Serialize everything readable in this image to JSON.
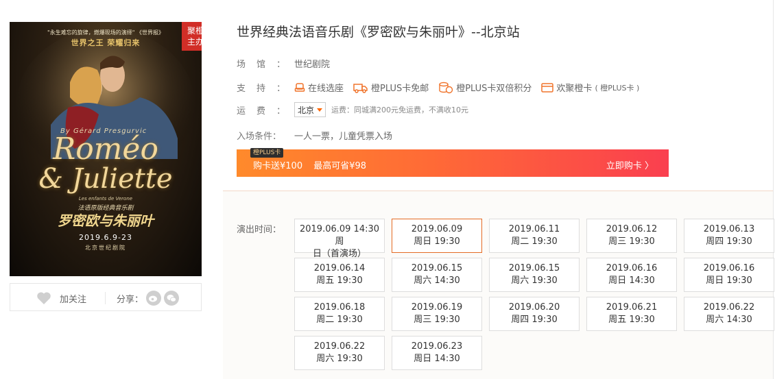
{
  "poster": {
    "tag": "聚橙\n主办",
    "quote": "\"永生难忘的旋律，燃爆现场的演绎\" 《世界报》",
    "slogan": "世界之王  荣耀归来",
    "author": "By Gérard Presgurvic",
    "title_line1": "Roméo",
    "title_line2": "& Juliette",
    "small_line": "Les enfants de Verone",
    "sub": "法语原版经典音乐剧",
    "cn_title": "罗密欧与朱丽叶",
    "dates": "2019.6.9-23",
    "venue": "北京世纪剧院"
  },
  "follow": {
    "label": "加关注",
    "icon": "heart-icon"
  },
  "share": {
    "label": "分享：",
    "icons": [
      "weibo-icon",
      "wechat-icon"
    ]
  },
  "title": "世界经典法语音乐剧《罗密欧与朱丽叶》--北京站",
  "venue": {
    "label": "场    馆：",
    "value": "世纪剧院"
  },
  "support": {
    "label": "支    持：",
    "items": [
      {
        "label": "在线选座",
        "icon": "seat-icon"
      },
      {
        "label": "橙PLUS卡免邮",
        "icon": "truck-icon"
      },
      {
        "label": "橙PLUS卡双倍积分",
        "icon": "coins-icon"
      },
      {
        "label": "欢聚橙卡",
        "note": "( 橙PLUS卡 )",
        "icon": "card-icon"
      }
    ]
  },
  "shipping": {
    "label": "运    费：",
    "city": "北京",
    "note": "运费：同城满200元免运费，不满收10元"
  },
  "entry": {
    "label": "入场条件：",
    "value": "一人一票，儿童凭票入场"
  },
  "promo": {
    "badge": "橙PLUS卡",
    "text1": "购卡送¥100",
    "text2": "最高可省¥98",
    "link": "立即购卡 〉"
  },
  "schedule": {
    "label": "演出时间：",
    "dates": [
      {
        "line1": "2019.06.09 14:30 周",
        "line2": "日（首演场）"
      },
      {
        "line1": "2019.06.09",
        "line2": "周日 19:30",
        "selected": true
      },
      {
        "line1": "2019.06.11",
        "line2": "周二 19:30"
      },
      {
        "line1": "2019.06.12",
        "line2": "周三 19:30"
      },
      {
        "line1": "2019.06.13",
        "line2": "周四 19:30"
      },
      {
        "line1": "2019.06.14",
        "line2": "周五 19:30"
      },
      {
        "line1": "2019.06.15",
        "line2": "周六 14:30"
      },
      {
        "line1": "2019.06.15",
        "line2": "周六 19:30"
      },
      {
        "line1": "2019.06.16",
        "line2": "周日 14:30"
      },
      {
        "line1": "2019.06.16",
        "line2": "周日 19:30"
      },
      {
        "line1": "2019.06.18",
        "line2": "周二 19:30"
      },
      {
        "line1": "2019.06.19",
        "line2": "周三 19:30"
      },
      {
        "line1": "2019.06.20",
        "line2": "周四 19:30"
      },
      {
        "line1": "2019.06.21",
        "line2": "周五 19:30"
      },
      {
        "line1": "2019.06.22",
        "line2": "周六 14:30"
      },
      {
        "line1": "2019.06.22",
        "line2": "周六 19:30"
      },
      {
        "line1": "2019.06.23",
        "line2": "周日 14:30"
      }
    ]
  },
  "colors": {
    "accent": "#ff6600",
    "selected_border": "#e46a23",
    "tag_red": "#d12e27"
  }
}
